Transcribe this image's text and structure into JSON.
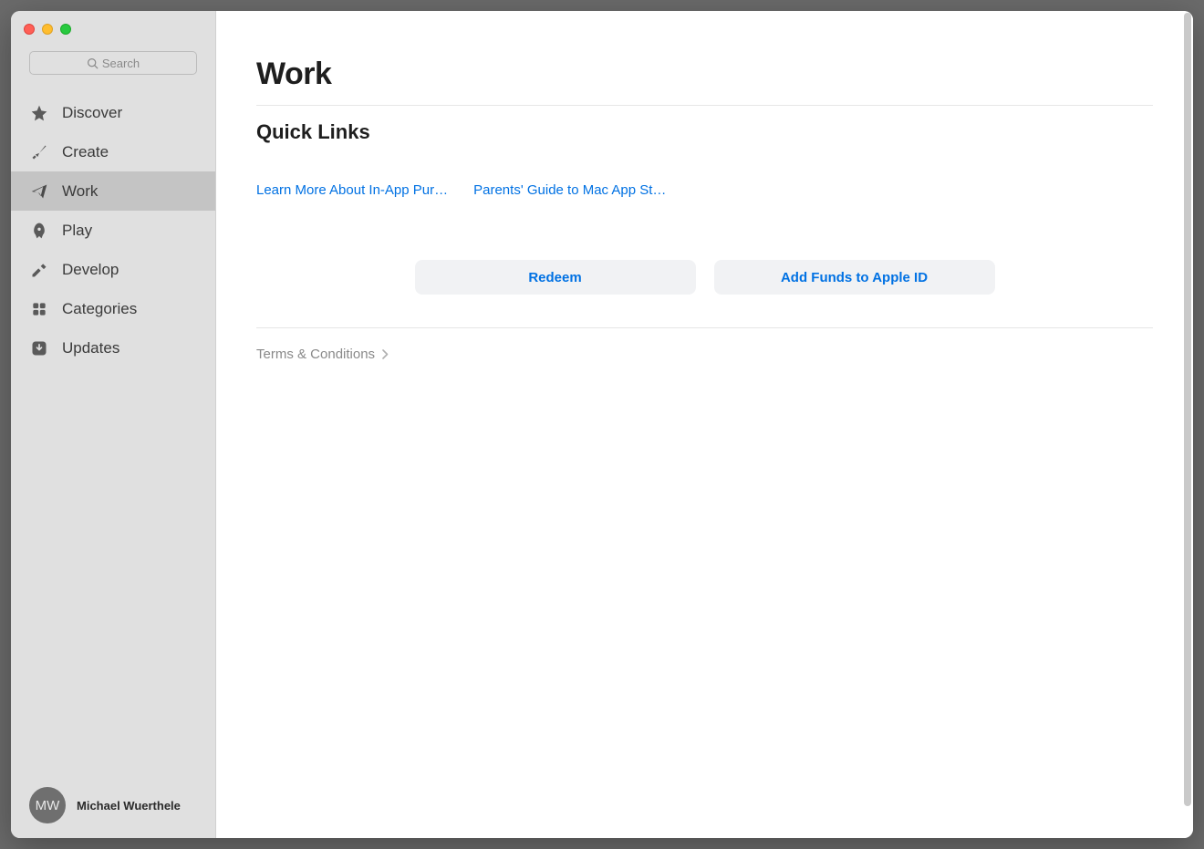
{
  "search": {
    "placeholder": "Search"
  },
  "sidebar": {
    "items": [
      {
        "label": "Discover"
      },
      {
        "label": "Create"
      },
      {
        "label": "Work"
      },
      {
        "label": "Play"
      },
      {
        "label": "Develop"
      },
      {
        "label": "Categories"
      },
      {
        "label": "Updates"
      }
    ],
    "active_index": 2
  },
  "user": {
    "initials": "MW",
    "name": "Michael Wuerthele"
  },
  "main": {
    "title": "Work",
    "section_title": "Quick Links",
    "quick_links": [
      "Learn More About In-App Pur…",
      "Parents' Guide to Mac App St…"
    ],
    "buttons": {
      "redeem": "Redeem",
      "add_funds": "Add Funds to Apple ID"
    },
    "terms": "Terms & Conditions"
  }
}
